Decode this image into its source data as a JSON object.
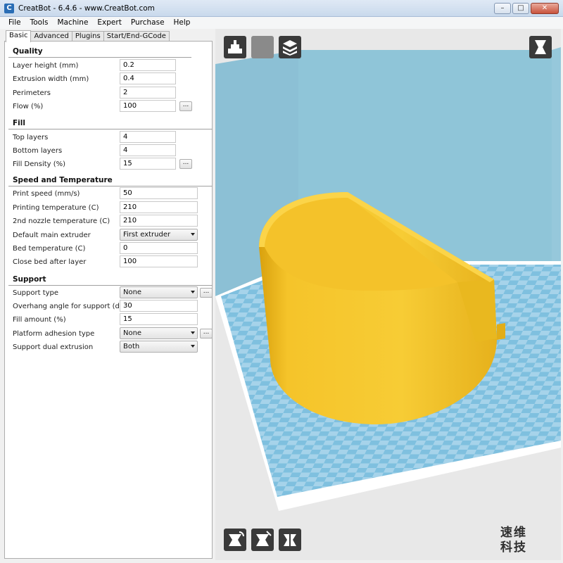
{
  "window": {
    "title": "CreatBot - 6.4.6 - www.CreatBot.com",
    "app_icon": "C",
    "minimize_glyph": "–",
    "maximize_glyph": "□",
    "close_glyph": "✕"
  },
  "menu": [
    "File",
    "Tools",
    "Machine",
    "Expert",
    "Purchase",
    "Help"
  ],
  "tabs": [
    "Basic",
    "Advanced",
    "Plugins",
    "Start/End-GCode"
  ],
  "sections": {
    "quality": "Quality",
    "fill": "Fill",
    "speed": "Speed and Temperature",
    "support": "Support"
  },
  "quality": {
    "layer_height": {
      "label": "Layer height (mm)",
      "value": "0.2"
    },
    "extrusion_width": {
      "label": "Extrusion width (mm)",
      "value": "0.4"
    },
    "perimeters": {
      "label": "Perimeters",
      "value": "2"
    },
    "flow": {
      "label": "Flow (%)",
      "value": "100"
    }
  },
  "fill": {
    "top_layers": {
      "label": "Top layers",
      "value": "4"
    },
    "bottom_layers": {
      "label": "Bottom layers",
      "value": "4"
    },
    "fill_density": {
      "label": "Fill Density (%)",
      "value": "15"
    }
  },
  "speed": {
    "print_speed": {
      "label": "Print speed (mm/s)",
      "value": "50"
    },
    "printing_temp": {
      "label": "Printing temperature (C)",
      "value": "210"
    },
    "nozzle2_temp": {
      "label": "2nd nozzle temperature (C)",
      "value": "210"
    },
    "main_extruder": {
      "label": "Default main extruder",
      "value": "First extruder"
    },
    "bed_temp": {
      "label": "Bed temperature (C)",
      "value": "0"
    },
    "close_bed": {
      "label": "Close bed after layer",
      "value": "100"
    }
  },
  "support": {
    "support_type": {
      "label": "Support type",
      "value": "None"
    },
    "overhang_angle": {
      "label": "Overhang angle for support (deg)",
      "value": "30"
    },
    "fill_amount": {
      "label": "Fill amount (%)",
      "value": "15"
    },
    "adhesion": {
      "label": "Platform adhesion type",
      "value": "None"
    },
    "dual_extrusion": {
      "label": "Support dual extrusion",
      "value": "Both"
    }
  },
  "more_button": "...",
  "watermark": [
    "速维",
    "科技"
  ],
  "colors": {
    "model": "#f2c42b",
    "build_volume": "#8fc5d8",
    "plate": "#ffffff",
    "checker_a": "#7fc0df",
    "checker_b": "#a6d3ea"
  },
  "toolbar_icons": [
    "load-model-icon",
    "save-icon",
    "layers-view-icon",
    "view-mode-icon"
  ],
  "bottom_icons": [
    "rotate-icon",
    "scale-icon",
    "mirror-icon"
  ]
}
